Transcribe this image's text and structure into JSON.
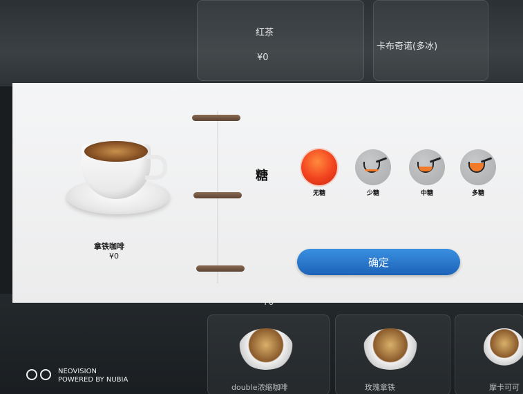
{
  "background": {
    "top_cards": [
      {
        "name": "红茶",
        "price": "¥0"
      },
      {
        "name": "卡布奇诺(多冰)",
        "price": ""
      }
    ],
    "bottom_price_left": "¥0",
    "bottom_labels": [
      "double浓缩咖啡",
      "玫瑰拿铁",
      "摩卡可可"
    ]
  },
  "product": {
    "name": "拿铁咖啡",
    "price": "¥0"
  },
  "sugar": {
    "label": "糖",
    "options": [
      {
        "label": "无糖",
        "icon": "no-sugar-icon",
        "selected": true
      },
      {
        "label": "少糖",
        "icon": "scoop-low-icon",
        "selected": false,
        "fill": 0.25
      },
      {
        "label": "中糖",
        "icon": "scoop-medium-icon",
        "selected": false,
        "fill": 0.5
      },
      {
        "label": "多糖",
        "icon": "scoop-high-icon",
        "selected": false,
        "fill": 0.85
      }
    ]
  },
  "confirm_label": "确定",
  "watermark": {
    "line1": "NEOVISION",
    "line2": "POWERED BY NUBIA"
  },
  "colors": {
    "accent": "#1c63b8",
    "selected": "#f2421f",
    "scoop_fill": "#f07a28"
  }
}
